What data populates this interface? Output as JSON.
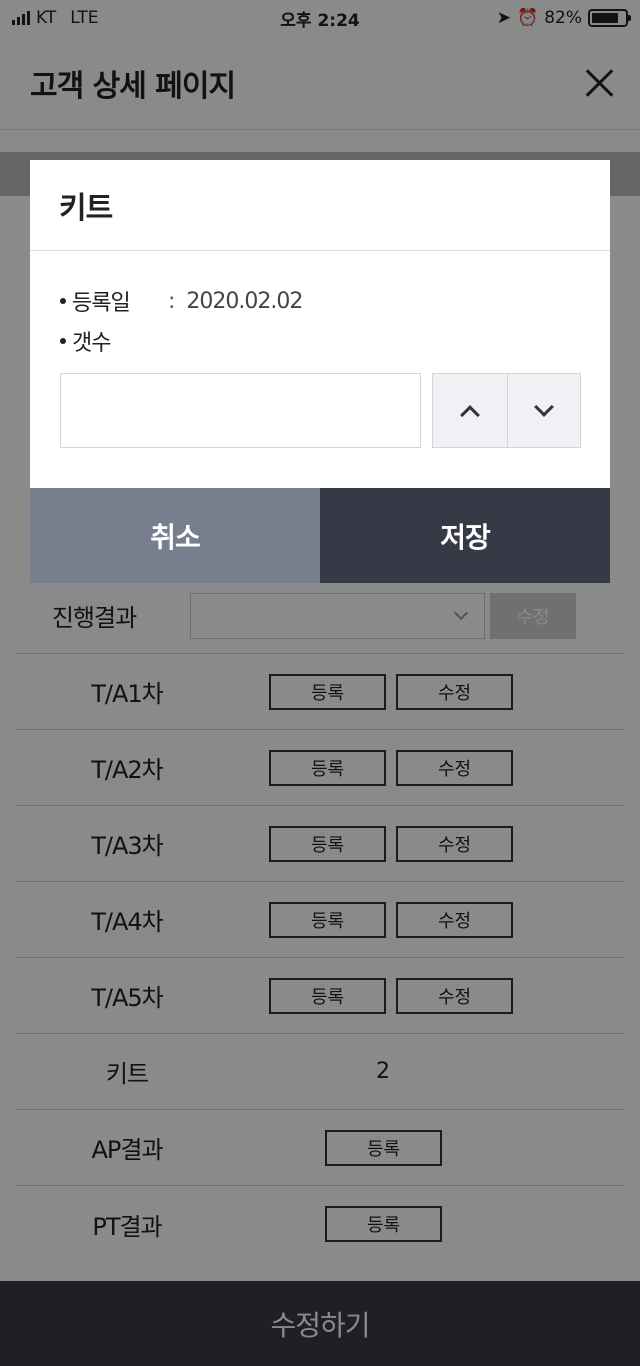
{
  "status_bar": {
    "carrier": "KT",
    "network": "LTE",
    "time": "오후 2:24",
    "battery": "82%",
    "battery_level": 0.82
  },
  "header": {
    "title": "고객 상세 페이지"
  },
  "rows": {
    "result": {
      "label": "진행결과",
      "select_value": "",
      "edit_label": "수정"
    },
    "ta1": {
      "label": "T/A1차",
      "register": "등록",
      "edit": "수정"
    },
    "ta2": {
      "label": "T/A2차",
      "register": "등록",
      "edit": "수정"
    },
    "ta3": {
      "label": "T/A3차",
      "register": "등록",
      "edit": "수정"
    },
    "ta4": {
      "label": "T/A4차",
      "register": "등록",
      "edit": "수정"
    },
    "ta5": {
      "label": "T/A5차",
      "register": "등록",
      "edit": "수정"
    },
    "kit": {
      "label": "키트",
      "value": "2"
    },
    "ap": {
      "label": "AP결과",
      "register": "등록"
    },
    "pt": {
      "label": "PT결과",
      "register": "등록"
    }
  },
  "bottom_bar": {
    "label": "수정하기"
  },
  "modal": {
    "title": "키트",
    "reg_label": "등록일",
    "colon": ":",
    "reg_date": "2020.02.02",
    "count_label": "갯수",
    "count_value": "",
    "cancel_label": "취소",
    "save_label": "저장"
  }
}
